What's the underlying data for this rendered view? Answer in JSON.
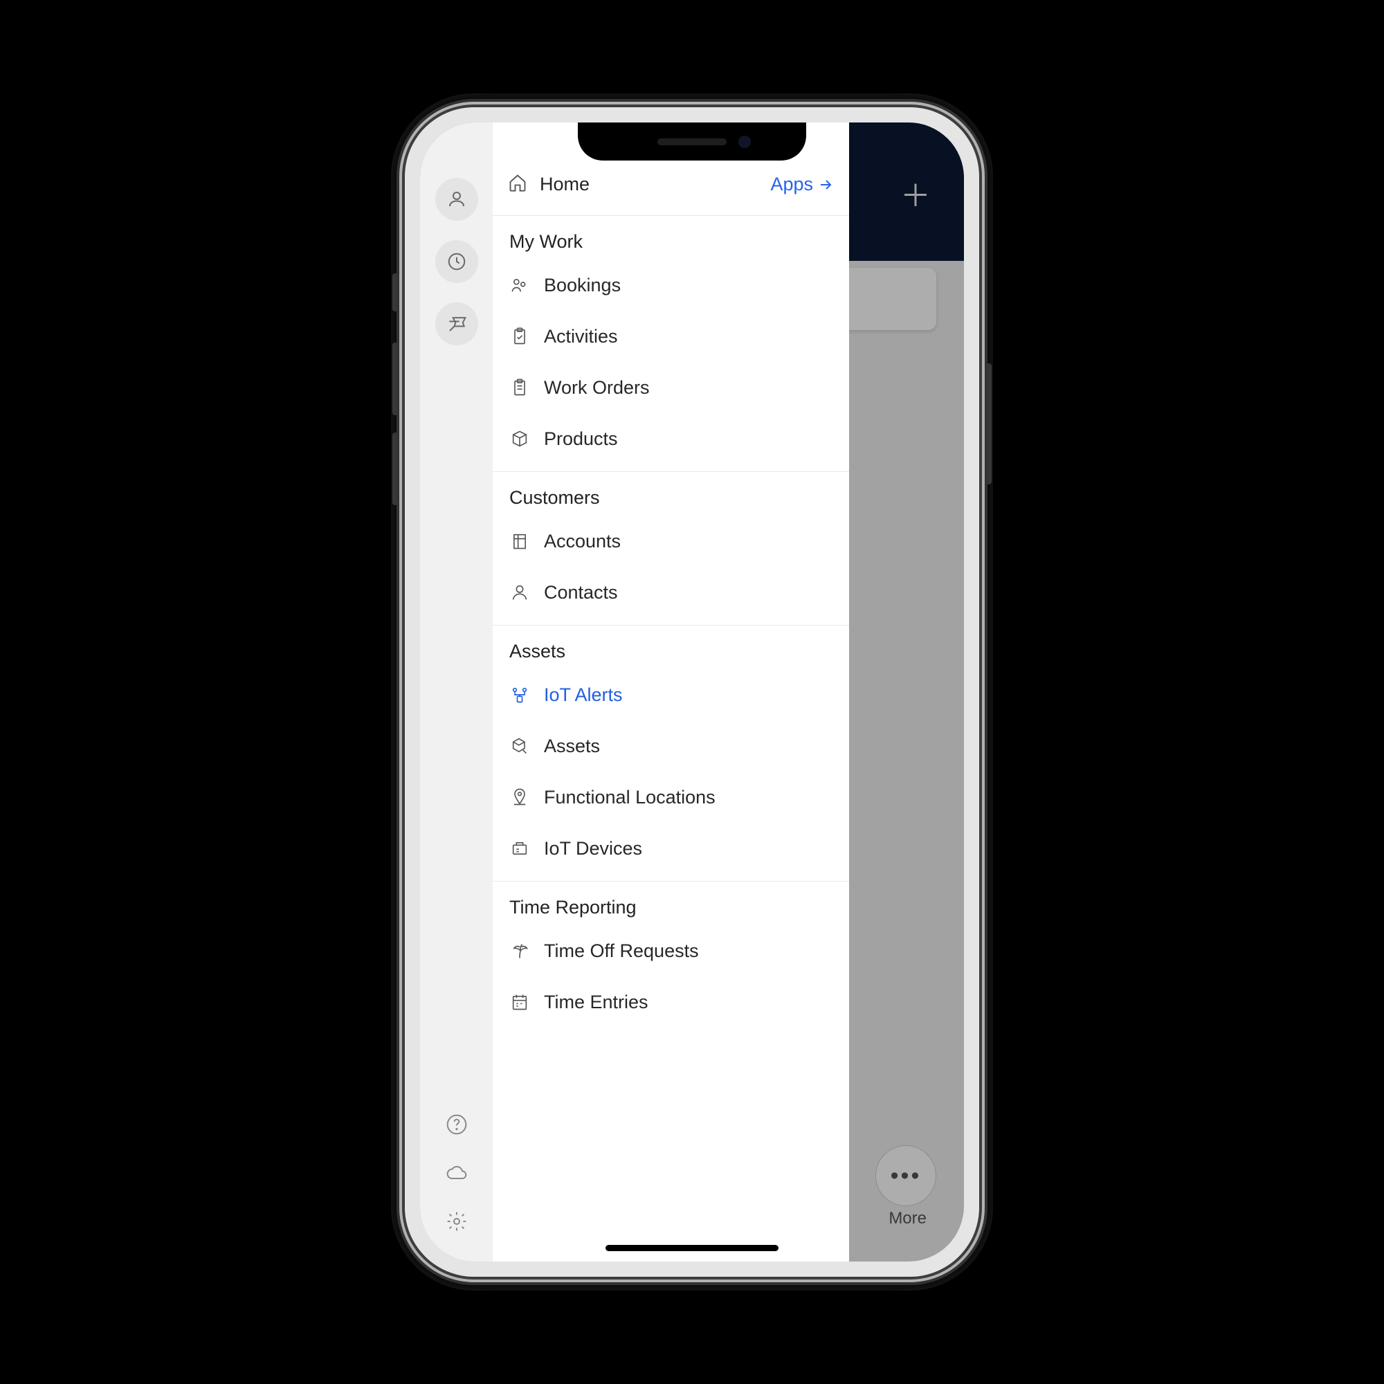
{
  "header": {
    "home_label": "Home",
    "apps_label": "Apps"
  },
  "sections": {
    "my_work": {
      "title": "My Work",
      "bookings": "Bookings",
      "activities": "Activities",
      "work_orders": "Work Orders",
      "products": "Products"
    },
    "customers": {
      "title": "Customers",
      "accounts": "Accounts",
      "contacts": "Contacts"
    },
    "assets": {
      "title": "Assets",
      "iot_alerts": "IoT Alerts",
      "assets": "Assets",
      "functional_locations": "Functional Locations",
      "iot_devices": "IoT Devices"
    },
    "time_reporting": {
      "title": "Time Reporting",
      "time_off": "Time Off Requests",
      "time_entries": "Time Entries"
    }
  },
  "background": {
    "more_label": "More"
  },
  "colors": {
    "accent": "#2060e0"
  }
}
